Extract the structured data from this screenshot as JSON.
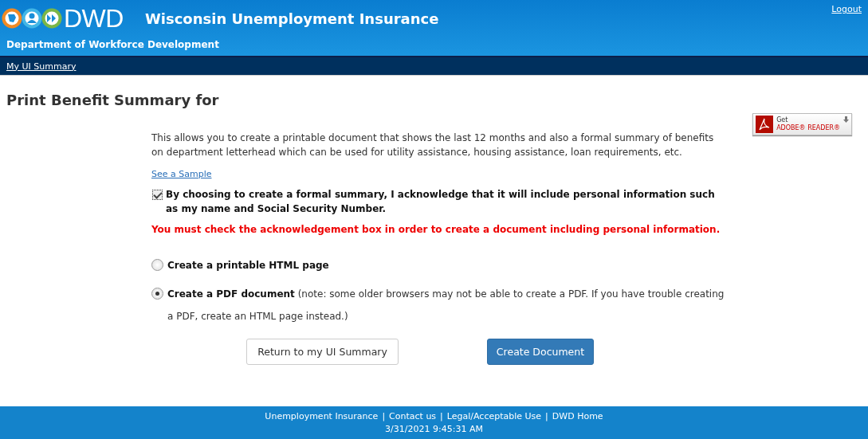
{
  "header": {
    "logo_text": "DWD",
    "title": "Wisconsin Unemployment Insurance",
    "subtitle": "Department of Workforce Development",
    "logout": "Logout"
  },
  "nav": {
    "items": [
      "My UI Summary"
    ]
  },
  "page_title": "Print Benefit Summary for",
  "adobe_badge": {
    "line1": "Get",
    "line2": "ADOBE® READER®"
  },
  "intro": "This allows you to create a printable document that shows the last 12 months and also a formal summary of benefits on department letterhead which can be used for utility assistance, housing assistance, loan requirements, etc.",
  "sample_link": "See a Sample",
  "acknowledge": {
    "label": "By choosing to create a formal summary, I acknowledge that it will include personal information such as my name and Social Security Number.",
    "checked": true
  },
  "error": "You must check the acknowledgement box in order to create a document including personal information.",
  "options": [
    {
      "label": "**Create a printable HTML page**",
      "selected": false
    },
    {
      "label": "**Create a PDF document** (note: some older browsers may not be able to create a PDF. If you have trouble creating a PDF, create an HTML page instead.)",
      "selected": true
    }
  ],
  "buttons": [
    {
      "label": "Return to my UI Summary",
      "kind": "secondary"
    },
    {
      "label": "Create Document",
      "kind": "primary"
    }
  ],
  "footer": {
    "links": [
      "Unemployment Insurance",
      "Contact us",
      "Legal/Acceptable Use",
      "DWD Home"
    ],
    "separator": "|",
    "timestamp": "3/31/2021 9:45:31 AM"
  }
}
